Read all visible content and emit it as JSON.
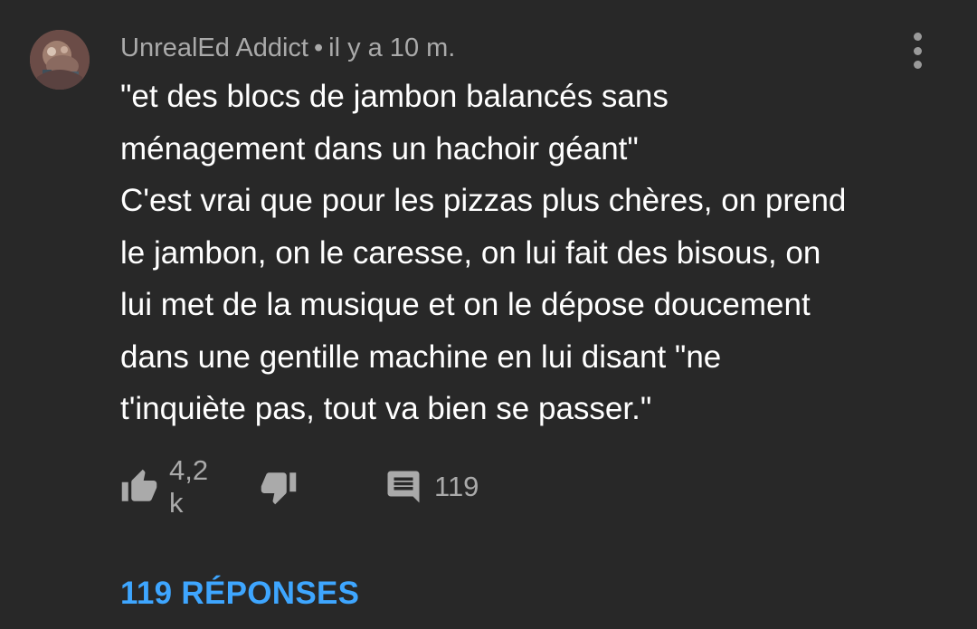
{
  "comment": {
    "author": "UnrealEd Addict",
    "separator": "•",
    "timestamp": "il y a 10 m.",
    "text_lines": [
      "\"et des blocs de jambon balancés sans",
      "ménagement dans un hachoir géant\"",
      "C'est vrai que pour les pizzas plus chères, on prend",
      "le jambon, on le caresse, on lui fait des bisous, on",
      "lui met de la musique et on le dépose doucement",
      "dans une gentille machine en lui disant \"ne",
      "t'inquiète pas, tout va bien se passer.\""
    ],
    "like_count": "4,2 k",
    "reply_count": "119",
    "replies_link": "119 RÉPONSES"
  },
  "icons": {
    "avatar": "avatar-image",
    "menu": "more-vert-icon",
    "like": "thumb-up-icon",
    "dislike": "thumb-down-icon",
    "comment": "comment-icon"
  },
  "colors": {
    "background": "#282828",
    "text": "#ffffff",
    "muted": "#aaaaaa",
    "link": "#3ea6ff"
  }
}
